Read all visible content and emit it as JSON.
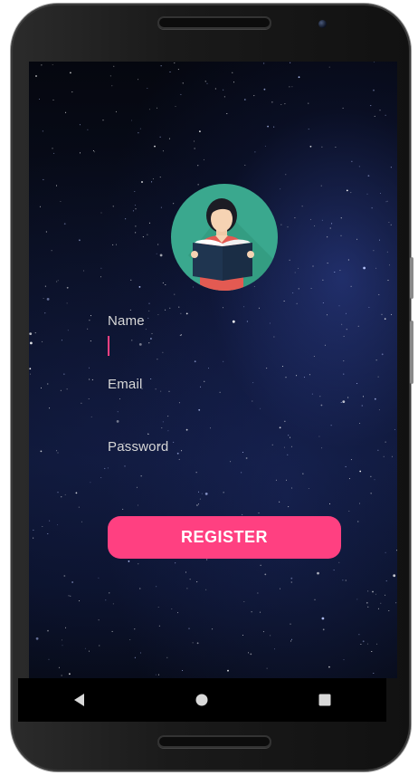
{
  "form": {
    "name_label": "Name",
    "email_label": "Email",
    "password_label": "Password",
    "name_value": "",
    "email_value": "",
    "password_value": ""
  },
  "register_button": {
    "label": "REGISTER"
  },
  "avatar": {
    "icon": "reader-avatar-icon"
  },
  "navigation": {
    "back_icon": "back-triangle-icon",
    "home_icon": "home-circle-icon",
    "recents_icon": "recents-square-icon"
  },
  "colors": {
    "accent": "#ff4081",
    "avatar_bg": "#3aa88e"
  }
}
